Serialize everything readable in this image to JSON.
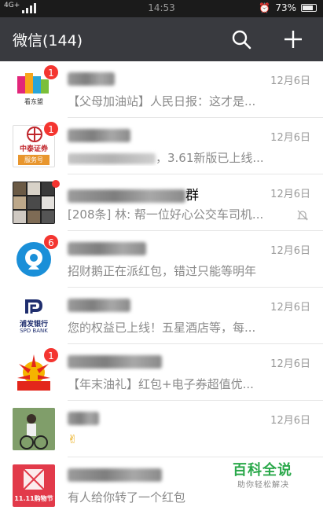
{
  "status_bar": {
    "network": "4G+",
    "time": "14:53",
    "battery": "73%"
  },
  "app_bar": {
    "title": "微信(144)",
    "search_icon": "search-icon",
    "add_icon": "plus-icon"
  },
  "chats": [
    {
      "name_visible": "",
      "time": "12月6日",
      "badge": "1",
      "message": "【父母加油站】人民日报：这才是...",
      "avatar_label": "看东盟"
    },
    {
      "name_visible": "",
      "time": "12月6日",
      "badge": "1",
      "message": "，3.61新版已上线...",
      "avatar_label": "中泰证券",
      "avatar_sub": "服务号"
    },
    {
      "name_visible": "群",
      "time": "12月6日",
      "badge": "",
      "message": "[208条] 林: 帮一位好心公交车司机...",
      "muted": true
    },
    {
      "name_visible": "",
      "time": "12月6日",
      "badge": "6",
      "message": "招财鹅正在派红包，错过只能等明年"
    },
    {
      "name_visible": "",
      "time": "12月6日",
      "badge": "",
      "message": "您的权益已上线！五星酒店等，每...",
      "avatar_label": "浦发银行",
      "avatar_sub": "SPD BANK"
    },
    {
      "name_visible": "",
      "time": "12月6日",
      "badge": "1",
      "message": "【年末油礼】红包+电子券超值优..."
    },
    {
      "name_visible": "",
      "time": "12月6日",
      "badge": "",
      "message": "✌"
    },
    {
      "name_visible": "",
      "time": "",
      "badge": "",
      "message": "有人给你转了一个红包",
      "avatar_label": "11.11购物节"
    }
  ],
  "watermark": {
    "title": "百科全说",
    "subtitle": "助你轻松解决"
  },
  "colors": {
    "app_bar": "#393a3f",
    "status_bar": "#1b1b1b",
    "badge": "#f43530",
    "watermark": "#2aa84a"
  }
}
